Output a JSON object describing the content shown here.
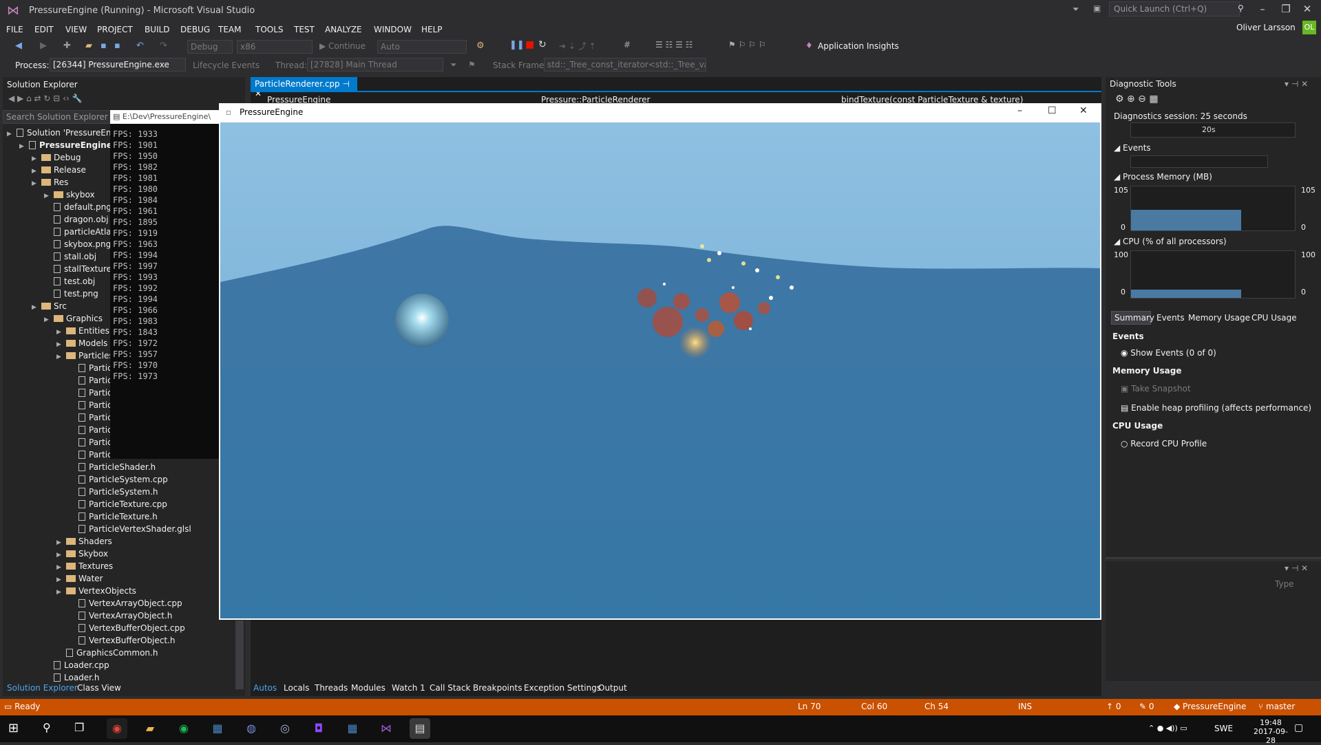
{
  "window": {
    "title": "PressureEngine (Running) - Microsoft Visual Studio",
    "quick_launch": "Quick Launch (Ctrl+Q)",
    "user": "Oliver Larsson",
    "avatar": "OL"
  },
  "menu": [
    "FILE",
    "EDIT",
    "VIEW",
    "PROJECT",
    "BUILD",
    "DEBUG",
    "TEAM",
    "TOOLS",
    "TEST",
    "ANALYZE",
    "WINDOW",
    "HELP"
  ],
  "toolbar": {
    "config": "Debug",
    "platform": "x86",
    "continue": "Continue",
    "auto": "Auto",
    "insights": "Application Insights"
  },
  "toolbar2": {
    "process_label": "Process:",
    "process": "[26344] PressureEngine.exe",
    "lifecycle": "Lifecycle Events",
    "thread_label": "Thread:",
    "thread": "[27828] Main Thread",
    "stack_label": "Stack Frame:",
    "stack": "std::_Tree_const_iterator<std::_Tree_val<st"
  },
  "solution_explorer": {
    "title": "Solution Explorer",
    "search": "Search Solution Explorer (Ctr",
    "items": [
      {
        "label": "Solution 'PressureEngin",
        "depth": 0,
        "type": "solution"
      },
      {
        "label": "PressureEngine",
        "depth": 1,
        "type": "project"
      },
      {
        "label": "Debug",
        "depth": 2,
        "type": "folder"
      },
      {
        "label": "Release",
        "depth": 2,
        "type": "folder"
      },
      {
        "label": "Res",
        "depth": 2,
        "type": "folder"
      },
      {
        "label": "skybox",
        "depth": 3,
        "type": "folder"
      },
      {
        "label": "default.png",
        "depth": 3,
        "type": "file"
      },
      {
        "label": "dragon.obj",
        "depth": 3,
        "type": "file"
      },
      {
        "label": "particleAtlas.",
        "depth": 3,
        "type": "file"
      },
      {
        "label": "skybox.png",
        "depth": 3,
        "type": "file"
      },
      {
        "label": "stall.obj",
        "depth": 3,
        "type": "file"
      },
      {
        "label": "stallTexture.p",
        "depth": 3,
        "type": "file"
      },
      {
        "label": "test.obj",
        "depth": 3,
        "type": "file"
      },
      {
        "label": "test.png",
        "depth": 3,
        "type": "file"
      },
      {
        "label": "Src",
        "depth": 2,
        "type": "folder"
      },
      {
        "label": "Graphics",
        "depth": 3,
        "type": "folder"
      },
      {
        "label": "Entities",
        "depth": 4,
        "type": "folder"
      },
      {
        "label": "Models",
        "depth": 4,
        "type": "folder"
      },
      {
        "label": "Particles",
        "depth": 4,
        "type": "folder"
      },
      {
        "label": "Particl",
        "depth": 5,
        "type": "file"
      },
      {
        "label": "Particl",
        "depth": 5,
        "type": "file"
      },
      {
        "label": "Particl",
        "depth": 5,
        "type": "file"
      },
      {
        "label": "Particl",
        "depth": 5,
        "type": "file"
      },
      {
        "label": "Particl",
        "depth": 5,
        "type": "file"
      },
      {
        "label": "Particl",
        "depth": 5,
        "type": "file"
      },
      {
        "label": "Particl",
        "depth": 5,
        "type": "file"
      },
      {
        "label": "Particl",
        "depth": 5,
        "type": "file"
      },
      {
        "label": "ParticleShader.h",
        "depth": 5,
        "type": "file"
      },
      {
        "label": "ParticleSystem.cpp",
        "depth": 5,
        "type": "file"
      },
      {
        "label": "ParticleSystem.h",
        "depth": 5,
        "type": "file"
      },
      {
        "label": "ParticleTexture.cpp",
        "depth": 5,
        "type": "file"
      },
      {
        "label": "ParticleTexture.h",
        "depth": 5,
        "type": "file"
      },
      {
        "label": "ParticleVertexShader.glsl",
        "depth": 5,
        "type": "file"
      },
      {
        "label": "Shaders",
        "depth": 4,
        "type": "folder"
      },
      {
        "label": "Skybox",
        "depth": 4,
        "type": "folder"
      },
      {
        "label": "Textures",
        "depth": 4,
        "type": "folder"
      },
      {
        "label": "Water",
        "depth": 4,
        "type": "folder"
      },
      {
        "label": "VertexObjects",
        "depth": 4,
        "type": "folder"
      },
      {
        "label": "VertexArrayObject.cpp",
        "depth": 5,
        "type": "file"
      },
      {
        "label": "VertexArrayObject.h",
        "depth": 5,
        "type": "file"
      },
      {
        "label": "VertexBufferObject.cpp",
        "depth": 5,
        "type": "file"
      },
      {
        "label": "VertexBufferObject.h",
        "depth": 5,
        "type": "file"
      },
      {
        "label": "GraphicsCommon.h",
        "depth": 4,
        "type": "file"
      },
      {
        "label": "Loader.cpp",
        "depth": 3,
        "type": "file"
      },
      {
        "label": "Loader.h",
        "depth": 3,
        "type": "file"
      }
    ],
    "bottom_tabs": [
      "Solution Explorer",
      "Class View"
    ]
  },
  "console": {
    "title": "E:\\Dev\\PressureEngine\\",
    "lines": [
      "FPS: 1933",
      "FPS: 1901",
      "FPS: 1950",
      "FPS: 1982",
      "FPS: 1981",
      "FPS: 1980",
      "FPS: 1984",
      "FPS: 1961",
      "FPS: 1895",
      "FPS: 1919",
      "FPS: 1963",
      "FPS: 1994",
      "FPS: 1997",
      "FPS: 1993",
      "FPS: 1992",
      "FPS: 1994",
      "FPS: 1966",
      "FPS: 1983",
      "FPS: 1843",
      "FPS: 1972",
      "FPS: 1957",
      "FPS: 1970",
      "FPS: 1973"
    ]
  },
  "editor": {
    "tab": "ParticleRenderer.cpp",
    "nav1": "PressureEngine",
    "nav2": "Pressure::ParticleRenderer",
    "nav3": "bindTexture(const ParticleTexture & texture)"
  },
  "game_window": {
    "title": "PressureEngine"
  },
  "diagnostics": {
    "title": "Diagnostic Tools",
    "session": "Diagnostics session: 25 seconds",
    "timeline_label": "20s",
    "events_label": "Events",
    "memory_label": "Process Memory (MB)",
    "memory_max": "105",
    "memory_min": "0",
    "cpu_label": "CPU (% of all processors)",
    "cpu_max": "100",
    "cpu_min": "0",
    "tabs": [
      "Summary",
      "Events",
      "Memory Usage",
      "CPU Usage"
    ],
    "sections": {
      "events": "Events",
      "show_events": "Show Events (0 of 0)",
      "memory": "Memory Usage",
      "snapshot": "Take Snapshot",
      "heap": "Enable heap profiling (affects performance)",
      "cpu": "CPU Usage",
      "record": "Record CPU Profile"
    },
    "type_label": "Type"
  },
  "debug_tabs": [
    "Autos",
    "Locals",
    "Threads",
    "Modules",
    "Watch 1",
    "Call Stack",
    "Breakpoints",
    "Exception Settings",
    "Output"
  ],
  "status": {
    "ready": "Ready",
    "ln": "Ln 70",
    "col": "Col 60",
    "ch": "Ch 54",
    "ins": "INS",
    "up": "0",
    "pencil": "0",
    "repo": "PressureEngine",
    "branch": "master"
  },
  "taskbar": {
    "lang": "SWE",
    "time": "19:48",
    "date": "2017-09-28"
  }
}
